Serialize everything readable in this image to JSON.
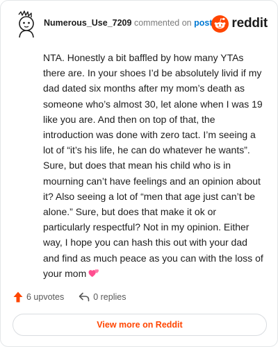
{
  "comment": {
    "username": "Numerous_Use_7209",
    "action_text": "commented on",
    "post_link_label": "post",
    "body": "NTA. Honestly a bit baffled by how many YTAs there are. In your shoes I’d be absolutely livid if my dad dated six months after my mom’s death as someone who’s almost 30, let alone when I was 19 like you are. And then on top of that, the introduction was done with zero tact. I’m seeing a lot of “it’s his life, he can do whatever he wants”. Sure, but does that mean his child who is in mourning can’t have feelings and an opinion about it? Also seeing a lot of “men that age just can’t be alone.” Sure, but does that make it ok or particularly respectful? Not in my opinion. Either way, I hope you can hash this out with your dad and find as much peace as you can with the loss of your mom",
    "emoji": "two-hearts"
  },
  "brand": {
    "name": "reddit",
    "icon": "reddit-snoo-icon",
    "color": "#ff4500"
  },
  "footer": {
    "upvotes_label": "6 upvotes",
    "upvote_icon": "upvote-arrow-icon",
    "upvote_color": "#ff4500",
    "replies_label": "0 replies",
    "reply_icon": "reply-arrow-icon"
  },
  "cta": {
    "label": "View more on Reddit"
  },
  "colors": {
    "accent": "#ff4500",
    "link": "#0079d3",
    "text": "#1c1c1c",
    "muted": "#7c7c7c",
    "heart": "#ff4d8f"
  }
}
